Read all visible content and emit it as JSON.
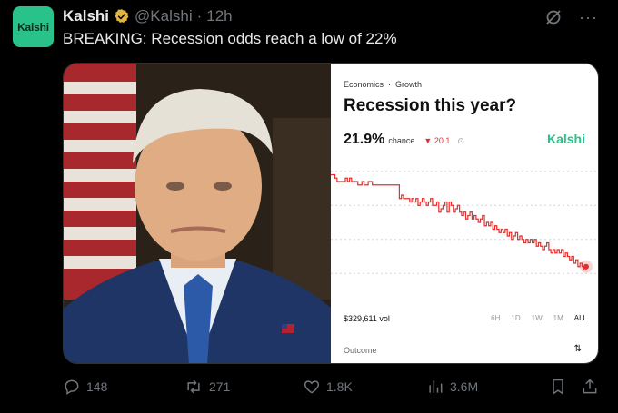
{
  "tweet": {
    "avatar_text": "Kalshi",
    "name": "Kalshi",
    "handle": "@Kalshi",
    "separator": "·",
    "time": "12h",
    "text": "BREAKING: Recession odds reach a low of 22%"
  },
  "card": {
    "breadcrumb": [
      "Economics",
      "·",
      "Growth"
    ],
    "title": "Recession this year?",
    "percent": "21.9%",
    "chance_label": "chance",
    "delta": "▼ 20.1",
    "brand": "Kalshi",
    "volume": "$329,611 vol",
    "ranges": [
      "6H",
      "1D",
      "1W",
      "1M",
      "ALL"
    ],
    "active_range": "ALL",
    "outcome_label": "Outcome",
    "sort_icon": "⇅"
  },
  "chart_data": {
    "type": "line",
    "y": [
      49,
      49,
      48,
      47,
      47,
      47,
      47,
      48,
      47,
      48,
      47,
      47,
      47,
      46,
      46,
      47,
      46,
      46,
      47,
      47,
      46,
      46,
      46,
      46,
      46,
      46,
      46,
      46,
      46,
      46,
      46,
      46,
      46,
      42,
      43,
      42,
      42,
      42,
      41,
      42,
      41,
      42,
      40,
      41,
      42,
      41,
      40,
      41,
      42,
      40,
      40,
      41,
      38,
      39,
      40,
      41,
      38,
      41,
      40,
      38,
      39,
      40,
      38,
      37,
      38,
      36,
      37,
      38,
      36,
      37,
      36,
      35,
      36,
      37,
      34,
      35,
      34,
      35,
      33,
      34,
      33,
      32,
      33,
      32,
      33,
      31,
      32,
      30,
      31,
      32,
      30,
      31,
      30,
      29,
      30,
      29,
      30,
      29,
      30,
      28,
      29,
      28,
      27,
      28,
      29,
      27,
      26,
      27,
      26,
      27,
      26,
      27,
      25,
      26,
      25,
      24,
      25,
      23,
      24,
      22,
      23,
      22,
      21,
      22
    ],
    "ylim": [
      15,
      55
    ],
    "color": "#e0302f",
    "grid": true
  },
  "stats": {
    "replies": "148",
    "reposts": "271",
    "likes": "1.8K",
    "views": "3.6M"
  },
  "colors": {
    "accent": "#28c28a",
    "negative": "#e0302f",
    "muted": "#71767b"
  }
}
